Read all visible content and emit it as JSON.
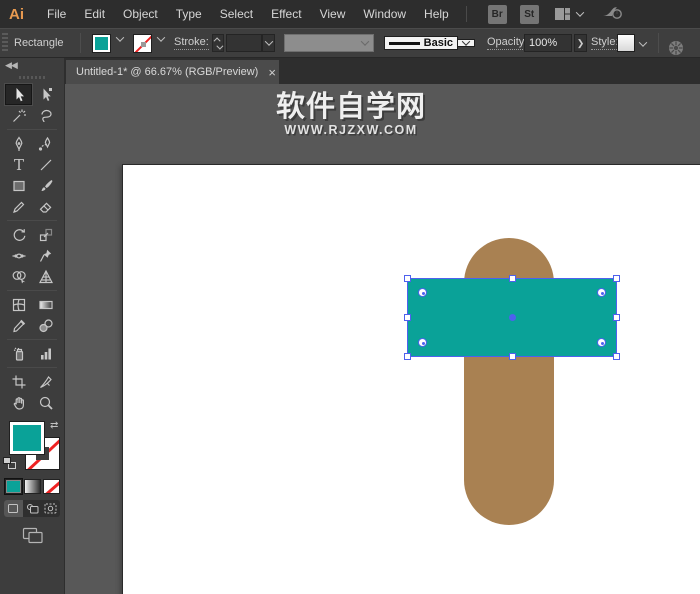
{
  "menubar": {
    "logo": "Ai",
    "items": [
      "File",
      "Edit",
      "Object",
      "Type",
      "Select",
      "Effect",
      "View",
      "Window",
      "Help"
    ],
    "br_button": "Br",
    "st_button": "St"
  },
  "controlbar": {
    "selection_label": "Rectangle",
    "stroke_label": "Stroke:",
    "brush_definition": "Basic",
    "opacity_label": "Opacity:",
    "opacity_value": "100%",
    "style_label": "Style:"
  },
  "tab": {
    "title": "Untitled-1* @ 66.67% (RGB/Preview)",
    "close": "×"
  },
  "toolbar": {
    "collapse": "◀◀",
    "tools": [
      "selection-tool",
      "direct-selection-tool",
      "magic-wand-tool",
      "lasso-tool",
      "pen-tool",
      "curvature-tool",
      "type-tool",
      "line-segment-tool",
      "rectangle-tool",
      "paintbrush-tool",
      "shaper-tool",
      "eraser-tool",
      "rotate-tool",
      "scale-tool",
      "width-tool",
      "puppet-warp-tool",
      "shape-builder-tool",
      "perspective-grid-tool",
      "mesh-tool",
      "gradient-tool",
      "eyedropper-tool",
      "blend-tool",
      "symbol-sprayer-tool",
      "column-graph-tool",
      "artboard-tool",
      "slice-tool",
      "hand-tool",
      "zoom-tool"
    ],
    "active_tool": "selection-tool",
    "swap_glyph": "⇄"
  },
  "watermark": {
    "title": "软件自学网",
    "subtitle": "WWW.RJZXW.COM"
  },
  "colors": {
    "teal": "#0aa298",
    "brown": "#a98152",
    "sel": "#4e61ee",
    "logo": "#e89a50"
  }
}
